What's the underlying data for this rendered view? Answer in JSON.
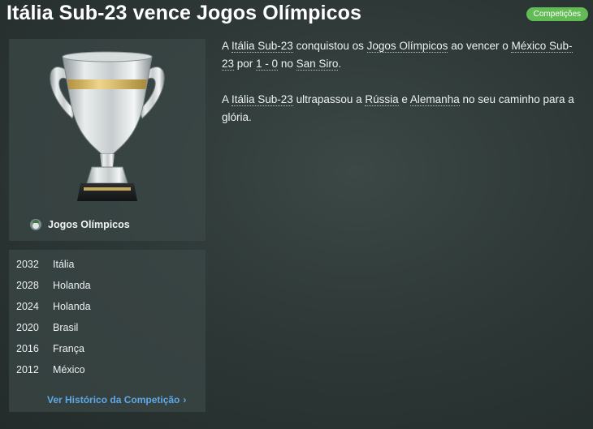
{
  "header": {
    "title": "Itália Sub-23 vence Jogos Olímpicos",
    "badge": "Competições"
  },
  "competition": {
    "name": "Jogos Olímpicos",
    "icon": "olympics-icon"
  },
  "history": {
    "rows": [
      {
        "year": "2032",
        "team": "Itália"
      },
      {
        "year": "2028",
        "team": "Holanda"
      },
      {
        "year": "2024",
        "team": "Holanda"
      },
      {
        "year": "2020",
        "team": "Brasil"
      },
      {
        "year": "2016",
        "team": "França"
      },
      {
        "year": "2012",
        "team": "México"
      }
    ],
    "link_label": "Ver Histórico da Competição"
  },
  "article": {
    "p1": {
      "t1": "A ",
      "winner": "Itália Sub-23",
      "t2": " conquistou os ",
      "competition": "Jogos Olímpicos",
      "t3": " ao vencer o ",
      "opponent": "México Sub-23",
      "t4": " por ",
      "score": "1 - 0",
      "t5": " no ",
      "stadium": "San Siro",
      "t6": "."
    },
    "p2": {
      "t1": "A ",
      "winner": "Itália Sub-23",
      "t2": " ultrapassou a ",
      "team1": "Rússia",
      "t3": " e ",
      "team2": "Alemanha",
      "t4": " no seu caminho para a glória."
    }
  },
  "colors": {
    "badge": "#63bb56",
    "link": "#5fa8e8",
    "trophy_band": "#d9b85a"
  }
}
